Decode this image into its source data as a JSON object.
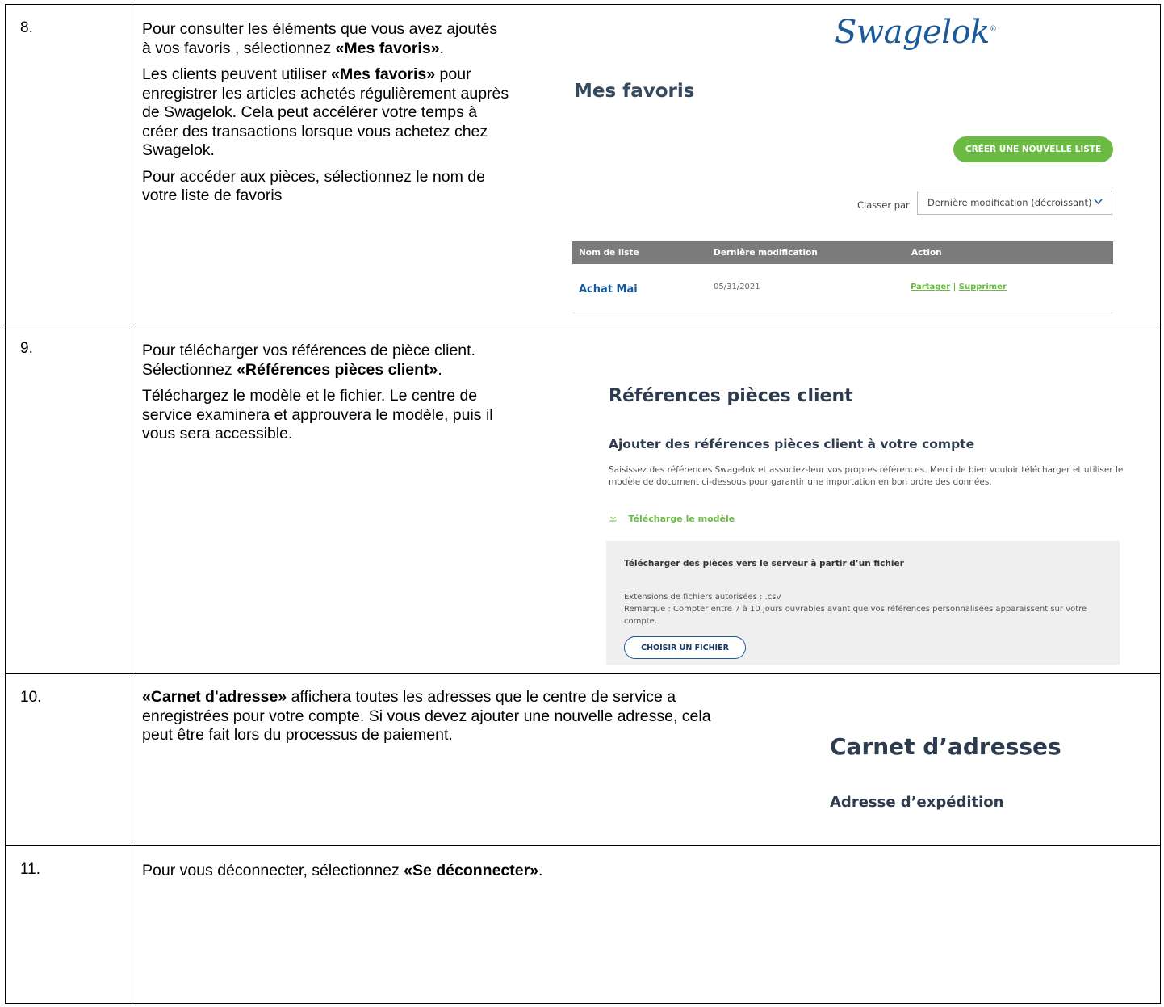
{
  "steps": [
    {
      "num": "8.",
      "paragraphs": [
        {
          "pre": "Pour consulter les éléments que vous avez ajoutés à vos favoris , sélectionnez ",
          "bold": "«Mes favoris»",
          "post": "."
        },
        {
          "pre": "Les clients peuvent utiliser ",
          "bold": "«Mes favoris»",
          "post": " pour enregistrer les articles achetés régulièrement auprès de Swagelok. Cela peut accélérer votre temps à créer des transactions lorsque vous achetez chez Swagelok."
        },
        {
          "pre": "Pour accéder aux pièces, sélectionnez le nom de votre liste de favoris",
          "bold": "",
          "post": ""
        }
      ]
    },
    {
      "num": "9.",
      "paragraphs": [
        {
          "pre": "Pour télécharger vos références de pièce client. Sélectionnez ",
          "bold": "«Références pièces client»",
          "post": "."
        },
        {
          "pre": "Téléchargez le modèle et le fichier. Le centre de service examinera et approuvera le modèle, puis il vous sera accessible.",
          "bold": "",
          "post": ""
        }
      ]
    },
    {
      "num": "10.",
      "paragraphs": [
        {
          "pre": "",
          "bold": "«Carnet d'adresse»",
          "post": " affichera toutes les adresses que le centre de service a enregistrées pour votre compte. Si vous devez ajouter une nouvelle adresse, cela peut être fait lors du processus de paiement."
        }
      ]
    },
    {
      "num": "11.",
      "paragraphs": [
        {
          "pre": "Pour vous déconnecter, sélectionnez ",
          "bold": "«Se déconnecter»",
          "post": "."
        }
      ]
    }
  ],
  "favorites": {
    "logo": "Swagelok",
    "logo_mark": "®",
    "title": "Mes favoris",
    "new_list_button": "CRÉER UNE NOUVELLE LISTE",
    "sort_label": "Classer par",
    "sort_value": "Dernière modification (décroissant)",
    "columns": [
      "Nom de liste",
      "Dernière modification",
      "Action"
    ],
    "row": {
      "name": "Achat Mai",
      "date": "05/31/2021",
      "share": "Partager",
      "separator": " | ",
      "delete": "Supprimer"
    }
  },
  "references": {
    "title": "Références pièces client",
    "subtitle": "Ajouter des références pièces client à votre compte",
    "description": "Saisissez des références Swagelok et associez-leur vos propres références. Merci de bien vouloir télécharger et utiliser le modèle de document ci-dessous pour garantir une importation en bon ordre des données.",
    "download_link": "Télécharge le modèle",
    "upload_title": "Télécharger des pièces vers le serveur à partir d’un fichier",
    "extensions": "Extensions de fichiers autorisées : .csv",
    "note": "Remarque : Compter entre 7 à 10 jours ouvrables avant que vos références personnalisées apparaissent sur votre compte.",
    "choose_file_button": "CHOISIR UN FICHIER"
  },
  "address": {
    "title": "Carnet d’adresses",
    "subtitle": "Adresse d’expédition"
  },
  "accent_colors": {
    "green": "#6aba44",
    "blue": "#1a5a9a",
    "header_gray": "#7b7b7b"
  }
}
